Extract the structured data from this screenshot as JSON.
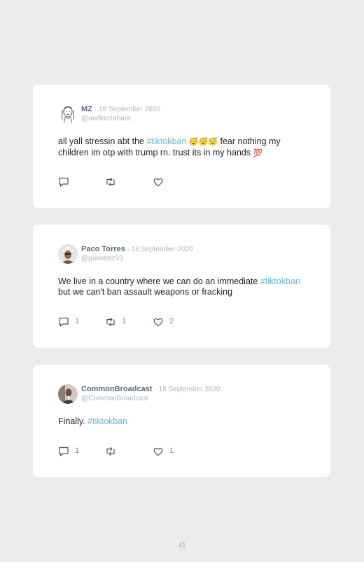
{
  "tweets": [
    {
      "name": "MZ",
      "date": "· 18 September 2020",
      "handle": "@mafinezahara",
      "text_before": "all yall stressin abt the ",
      "hashtag": "#tiktokban",
      "emoji_1": "😴😴😴",
      "text_after": " fear nothing my children im otp with trump rn. trust its in my hands ",
      "emoji_2": "💯",
      "reply_count": "",
      "retweet_count": "",
      "like_count": ""
    },
    {
      "name": "Paco Torres",
      "date": "· 18 September 2020",
      "handle": "@pakotorz93",
      "text_before": "We live in a country where we can do an immediate ",
      "hashtag": "#tiktokban",
      "text_after": " but we can't ban assault weapons or fracking",
      "reply_count": "1",
      "retweet_count": "1",
      "like_count": "2"
    },
    {
      "name": "CommonBroadcast",
      "date": "· 18 September 2020",
      "handle": "@CommonBroadcast",
      "text_before": "Finally. ",
      "hashtag": "#tiktokban",
      "reply_count": "1",
      "retweet_count": "",
      "like_count": "1"
    }
  ],
  "icons": {
    "reply": "speech-bubble-icon",
    "retweet": "retweet-icon",
    "like": "heart-icon"
  },
  "colors": {
    "hashtag": "#6ab4dc",
    "name": "#5b6b7b",
    "muted": "#a9b5c0",
    "background": "#ececec",
    "card": "#ffffff"
  },
  "page_number": "41"
}
